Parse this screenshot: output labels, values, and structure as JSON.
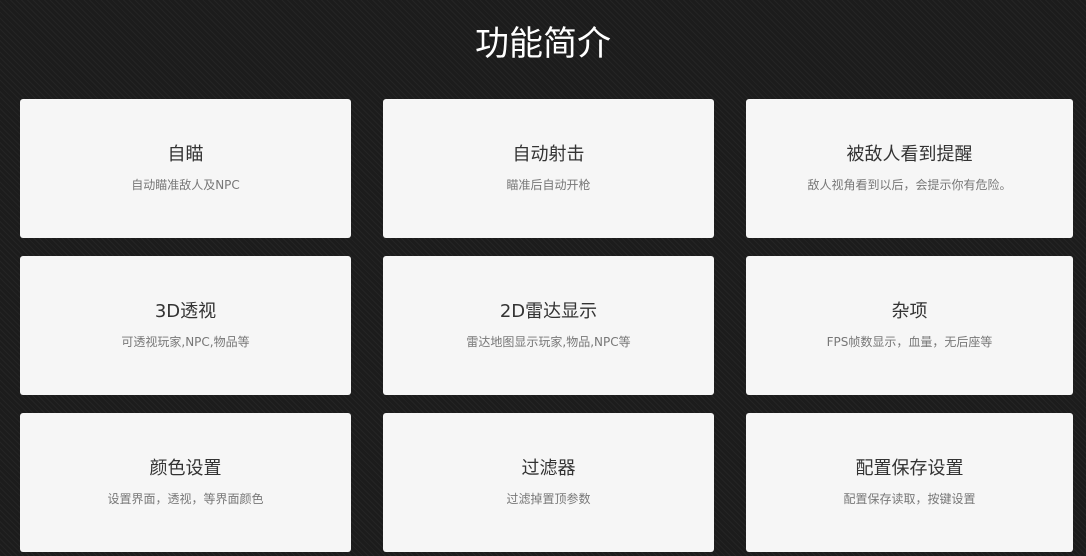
{
  "section": {
    "title": "功能简介"
  },
  "features": [
    {
      "title": "自瞄",
      "desc": "自动瞄准敌人及NPC"
    },
    {
      "title": "自动射击",
      "desc": "瞄准后自动开枪"
    },
    {
      "title": "被敌人看到提醒",
      "desc": "敌人视角看到以后，会提示你有危险。"
    },
    {
      "title": "3D透视",
      "desc": "可透视玩家,NPC,物品等"
    },
    {
      "title": "2D雷达显示",
      "desc": "雷达地图显示玩家,物品,NPC等"
    },
    {
      "title": "杂项",
      "desc": "FPS帧数显示，血量，无后座等"
    },
    {
      "title": "颜色设置",
      "desc": "设置界面，透视，等界面颜色"
    },
    {
      "title": "过滤器",
      "desc": "过滤掉置顶参数"
    },
    {
      "title": "配置保存设置",
      "desc": "配置保存读取，按键设置"
    }
  ]
}
